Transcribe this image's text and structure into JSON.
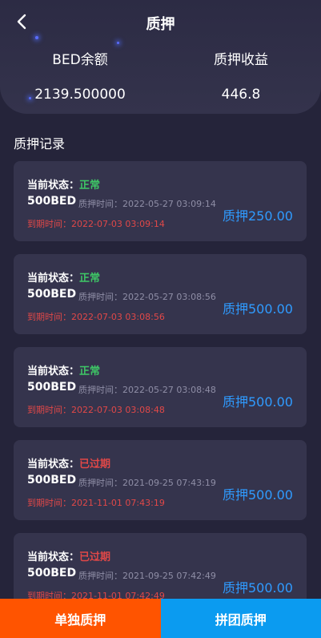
{
  "header": {
    "title": "质押",
    "balance_label": "BED余额",
    "balance_value": "2139.500000",
    "income_label": "质押收益",
    "income_value": "446.8"
  },
  "section_title": "质押记录",
  "records": [
    {
      "status_label": "当前状态：",
      "status": "正常",
      "amount": "500BED",
      "pledge_time": "质押时间：2022-05-27 03:09:14",
      "expire_time": "到期时间：2022-07-03 03:09:14",
      "pledge_amount": "质押250.00"
    },
    {
      "status_label": "当前状态：",
      "status": "正常",
      "amount": "500BED",
      "pledge_time": "质押时间：2022-05-27 03:08:56",
      "expire_time": "到期时间：2022-07-03 03:08:56",
      "pledge_amount": "质押500.00"
    },
    {
      "status_label": "当前状态：",
      "status": "正常",
      "amount": "500BED",
      "pledge_time": "质押时间：2022-05-27 03:08:48",
      "expire_time": "到期时间：2022-07-03 03:08:48",
      "pledge_amount": "质押500.00"
    },
    {
      "status_label": "当前状态：",
      "status": "已过期",
      "amount": "500BED",
      "pledge_time": "质押时间：2021-09-25 07:43:19",
      "expire_time": "到期时间：2021-11-01 07:43:19",
      "pledge_amount": "质押500.00"
    },
    {
      "status_label": "当前状态：",
      "status": "已过期",
      "amount": "500BED",
      "pledge_time": "质押时间：2021-09-25 07:42:49",
      "expire_time": "到期时间：2021-11-01 07:42:49",
      "pledge_amount": "质押500.00"
    }
  ],
  "bottom": {
    "single_label": "单独质押",
    "group_label": "拼团质押"
  },
  "colors": {
    "status_ok": "#3ec766",
    "status_expired": "#e04848",
    "accent_blue": "#2f9bff",
    "btn_single": "#ff5400",
    "btn_group": "#0b9bf0"
  },
  "icons": {
    "back": "chevron-left-icon"
  }
}
